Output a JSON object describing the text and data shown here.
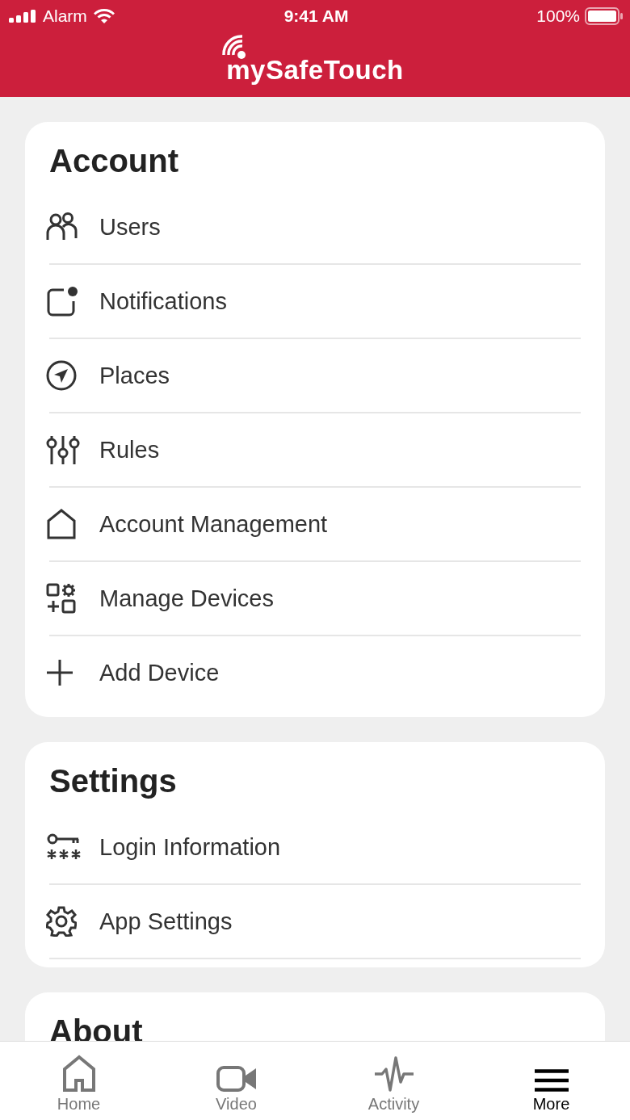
{
  "status_bar": {
    "carrier": "Alarm",
    "time": "9:41 AM",
    "battery": "100%"
  },
  "header": {
    "logo": "mySafeTouch"
  },
  "sections": [
    {
      "title": "Account",
      "items": [
        {
          "label": "Users"
        },
        {
          "label": "Notifications"
        },
        {
          "label": "Places"
        },
        {
          "label": "Rules"
        },
        {
          "label": "Account Management"
        },
        {
          "label": "Manage Devices"
        },
        {
          "label": "Add Device"
        }
      ]
    },
    {
      "title": "Settings",
      "items": [
        {
          "label": "Login Information"
        },
        {
          "label": "App Settings"
        }
      ]
    },
    {
      "title": "About"
    }
  ],
  "tabs": [
    {
      "label": "Home",
      "selected": false
    },
    {
      "label": "Video",
      "selected": false
    },
    {
      "label": "Activity",
      "selected": false
    },
    {
      "label": "More",
      "selected": true
    }
  ]
}
